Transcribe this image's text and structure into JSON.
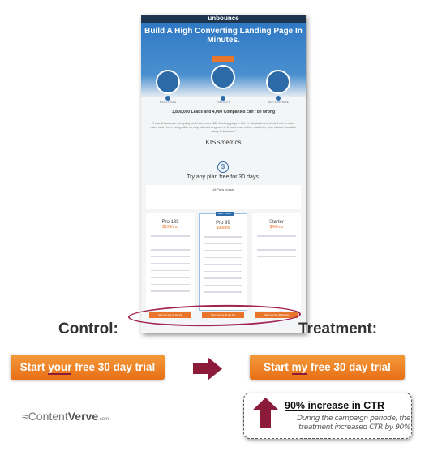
{
  "landing_page": {
    "brand": "unbounce",
    "headline": "Build A High Converting Landing Page In Minutes.",
    "steps": [
      "BUILD A PAGE",
      "PUBLISH IT",
      "TEST & OPTIMIZE"
    ],
    "social_proof": "3,800,000 Leads and 4,000 Companies can't be wrong",
    "quote": "\"I use Unbounce everyday and have over 100 landing pages. We've doubled and tripled conversion rates and I love being able to ship without engineers. If you're an online marketer, you should consider using Unbounce.\"",
    "quote_company": "KISSmetrics",
    "offer_title": "Try any plan free for 30 days.",
    "all_plans_label": "All Plans Include",
    "plans": [
      {
        "name": "Pro 199",
        "price": "$199/mo",
        "button": "Start your free 30 day trial"
      },
      {
        "name": "Pro 99",
        "price": "$99/mo",
        "badge": "BEST VALUE",
        "button": "Start your free 30 day trial"
      },
      {
        "name": "Starter",
        "price": "$49/mo",
        "button": "Start your free 30 day trial"
      }
    ]
  },
  "control": {
    "label": "Control:",
    "button_pre": "Start ",
    "button_word": "your",
    "button_post": " free 30 day trial"
  },
  "treatment": {
    "label": "Treatment:",
    "button_pre": "Start ",
    "button_word": "my",
    "button_post": " free 30 day trial"
  },
  "result": {
    "headline": "90% increase in CTR",
    "description": "During the campaign periode, the treatment increased CTR by 90%"
  },
  "logo": {
    "text_a": "Content",
    "text_b": "Verve",
    "suffix": ".com"
  },
  "colors": {
    "accent_orange": "#e8752a",
    "maroon": "#8c1b3a",
    "blue": "#2d6aa8"
  }
}
